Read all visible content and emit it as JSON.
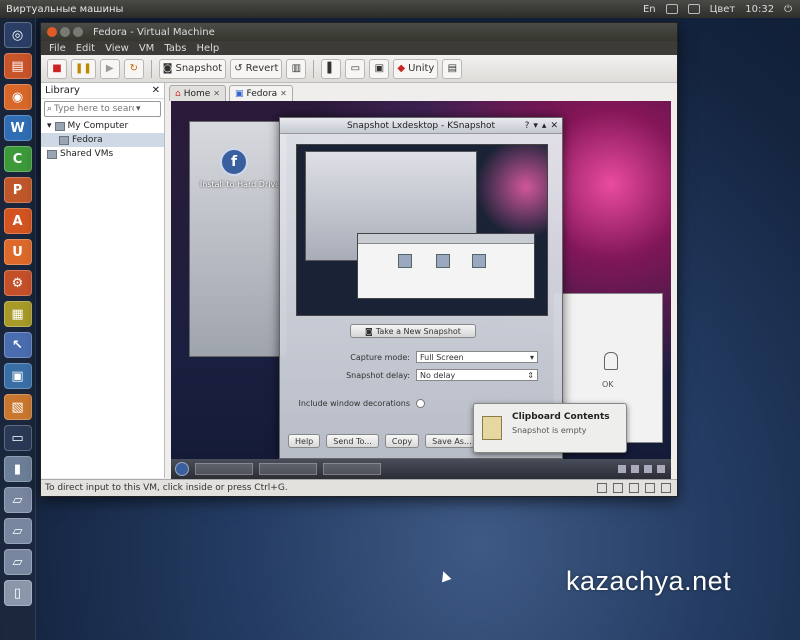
{
  "top_panel": {
    "app_title": "Виртуальные машины",
    "tray_labels": [
      "En",
      "Цвет",
      "10:32"
    ]
  },
  "launcher": {
    "items": [
      {
        "name": "dash-home",
        "glyph": "◎",
        "color": "#2b3f66"
      },
      {
        "name": "files",
        "glyph": "▤",
        "color": "#c8542a"
      },
      {
        "name": "firefox",
        "glyph": "◉",
        "color": "#d8682a"
      },
      {
        "name": "writer",
        "glyph": "W",
        "color": "#2f6db5"
      },
      {
        "name": "calc",
        "glyph": "C",
        "color": "#3d9a3b"
      },
      {
        "name": "impress",
        "glyph": "P",
        "color": "#c0572a"
      },
      {
        "name": "software-center",
        "glyph": "A",
        "color": "#d35421"
      },
      {
        "name": "ubuntu-one",
        "glyph": "U",
        "color": "#dd6a2b"
      },
      {
        "name": "settings",
        "glyph": "⚙",
        "color": "#c4502a"
      },
      {
        "name": "workspaces",
        "glyph": "▦",
        "color": "#a89a28"
      },
      {
        "name": "cursor-tool",
        "glyph": "↖",
        "color": "#4a6db0"
      },
      {
        "name": "virt-manager",
        "glyph": "▣",
        "color": "#3a6fa6"
      },
      {
        "name": "archive",
        "glyph": "▧",
        "color": "#c9772f"
      },
      {
        "name": "terminal",
        "glyph": "▭",
        "color": "#2a3a56"
      },
      {
        "name": "usb-drive",
        "glyph": "▮",
        "color": "#6d7f98"
      },
      {
        "name": "drive-a",
        "glyph": "▱",
        "color": "#7886a0"
      },
      {
        "name": "drive-b",
        "glyph": "▱",
        "color": "#7886a0"
      },
      {
        "name": "drive-c",
        "glyph": "▱",
        "color": "#7886a0"
      },
      {
        "name": "trash",
        "glyph": "▯",
        "color": "#8a96aa"
      }
    ]
  },
  "window": {
    "title": "Fedora - Virtual Machine",
    "menu": [
      "File",
      "Edit",
      "View",
      "VM",
      "Tabs",
      "Help"
    ],
    "toolbar": {
      "snapshot_label": "Snapshot",
      "revert_label": "Revert",
      "unity_label": "Unity"
    },
    "sidebar": {
      "header": "Library",
      "search_placeholder": "Type here to search",
      "items": [
        "My Computer",
        "Fedora",
        "Shared VMs"
      ]
    },
    "tabs": [
      "Home",
      "Fedora"
    ],
    "status_text": "To direct input to this VM, click inside or press Ctrl+G."
  },
  "guest": {
    "desktop_icon_label": "Install to Hard Drive",
    "snapshot_dialog": {
      "title": "Snapshot Lxdesktop - KSnapshot",
      "take_button": "Take a New Snapshot",
      "capture_mode_label": "Capture mode:",
      "capture_mode_value": "Full Screen",
      "delay_label": "Snapshot delay:",
      "delay_value": "No delay",
      "include_label": "Include window decorations",
      "buttons": [
        "Help",
        "Send To...",
        "Copy",
        "Save As..."
      ]
    },
    "right_panel_label": "OK",
    "notification": {
      "title": "Clipboard Contents",
      "subtitle": "Snapshot is empty"
    }
  },
  "watermark": "kazachya.net"
}
